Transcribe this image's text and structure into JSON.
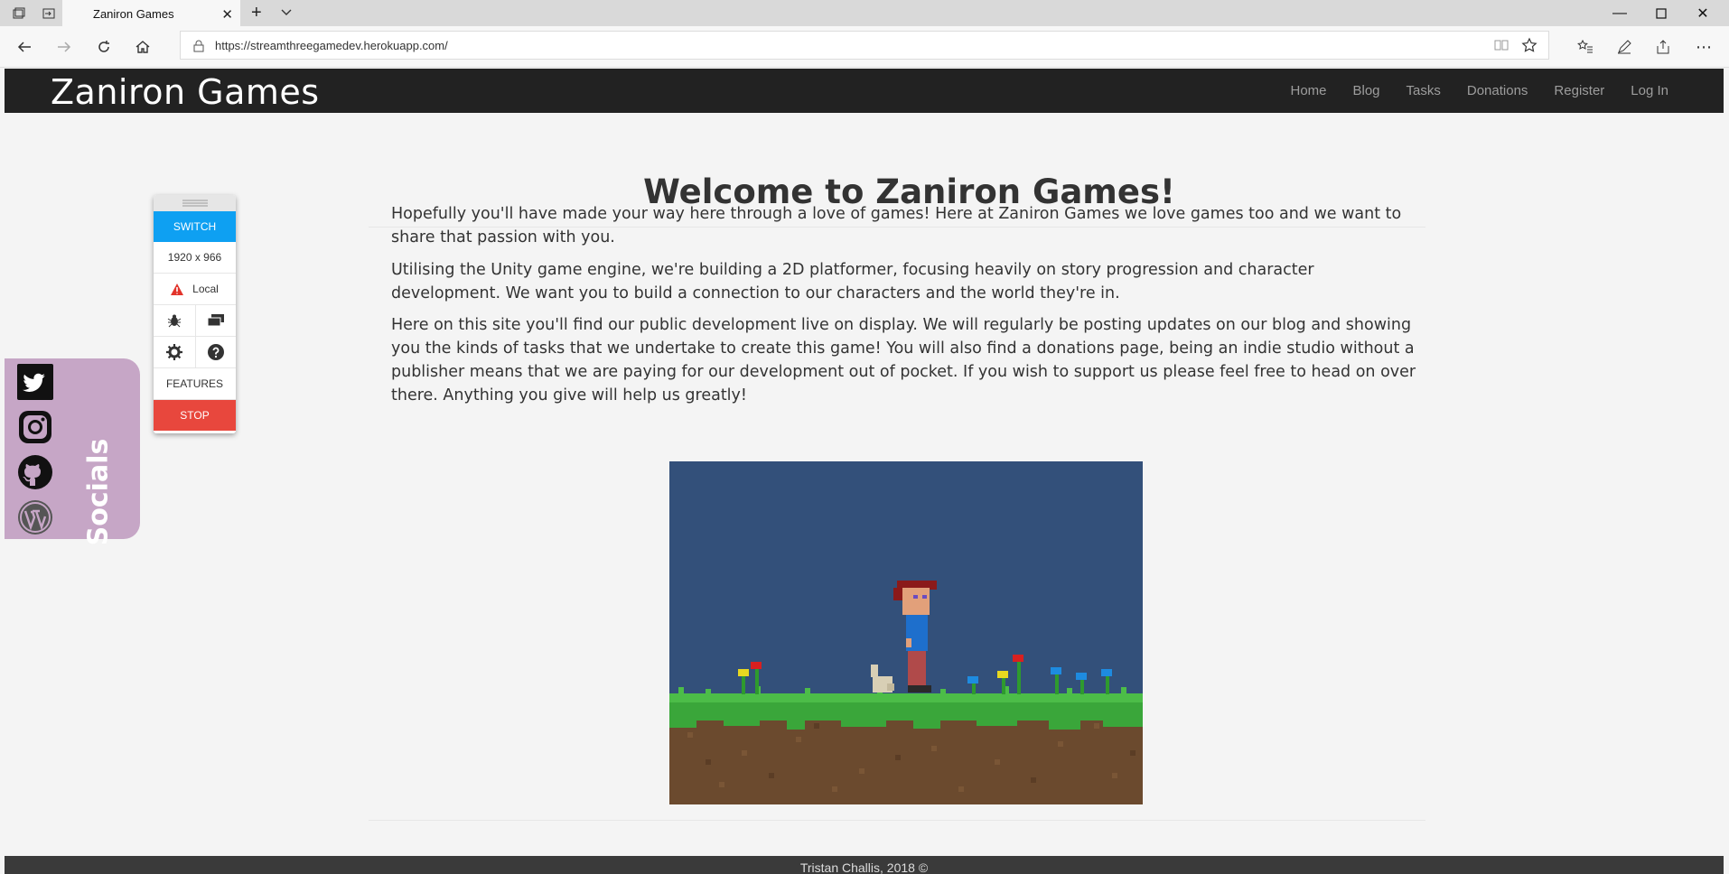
{
  "browser": {
    "tab_title": "Zaniron Games",
    "url": "https://streamthreegamedev.herokuapp.com/"
  },
  "site": {
    "brand": "Zaniron Games",
    "nav": [
      "Home",
      "Blog",
      "Tasks",
      "Donations",
      "Register",
      "Log In"
    ]
  },
  "main": {
    "title": "Welcome to Zaniron Games!",
    "paragraphs": [
      "Hopefully you'll have made your way here through a love of games! Here at Zaniron Games we love games too and we want to share that passion with you.",
      "Utilising the Unity game engine, we're building a 2D platformer, focusing heavily on story progression and character development. We want you to build a connection to our characters and the world they're in.",
      "Here on this site you'll find our public development live on display. We will regularly be posting updates on our blog and showing you the kinds of tasks that we undertake to create this game! You will also find a donations page, being an indie studio without a publisher means that we are paying for our development out of pocket. If you wish to support us please feel free to head on over there. Anything you give will help us greatly!"
    ]
  },
  "footer": {
    "text": "Tristan Challis, 2018 ©"
  },
  "socials": {
    "label": "Socials",
    "icons": [
      "twitter-icon",
      "instagram-icon",
      "github-icon",
      "wordpress-icon"
    ]
  },
  "toolbar": {
    "switch": "SWITCH",
    "resolution": "1920 x 966",
    "env": "Local",
    "features": "FEATURES",
    "stop": "STOP"
  },
  "colors": {
    "header_bg": "#222222",
    "socials_bg": "#c6a6c6",
    "switch_blue": "#0ea0f2",
    "stop_red": "#e8473d",
    "game_sky": "#33507a"
  }
}
